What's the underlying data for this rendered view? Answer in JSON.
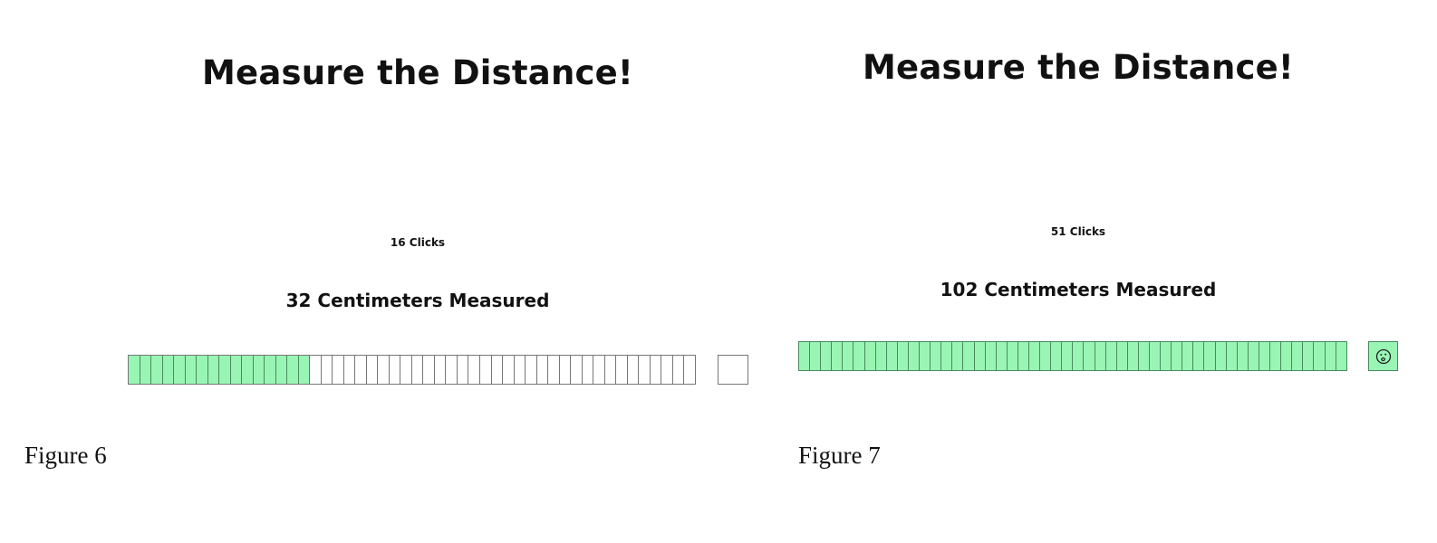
{
  "figures": [
    {
      "title": "Measure the Distance!",
      "clicks": "16 Clicks",
      "measured": "32 Centimeters Measured",
      "ruler": {
        "total_segments": 50,
        "filled_segments": 16
      },
      "end_box": {
        "state": "empty",
        "icon": ""
      },
      "caption": "Figure 6"
    },
    {
      "title": "Measure the Distance!",
      "clicks": "51 Clicks",
      "measured": "102 Centimeters Measured",
      "ruler": {
        "total_segments": 50,
        "filled_segments": 50
      },
      "end_box": {
        "state": "reached",
        "icon": "surprised-face-icon"
      },
      "caption": "Figure 7"
    }
  ],
  "colors": {
    "filled_segment": "#99f5b4",
    "segment_border": "#777777",
    "filled_border": "#4a8a5e",
    "text": "#111111"
  }
}
